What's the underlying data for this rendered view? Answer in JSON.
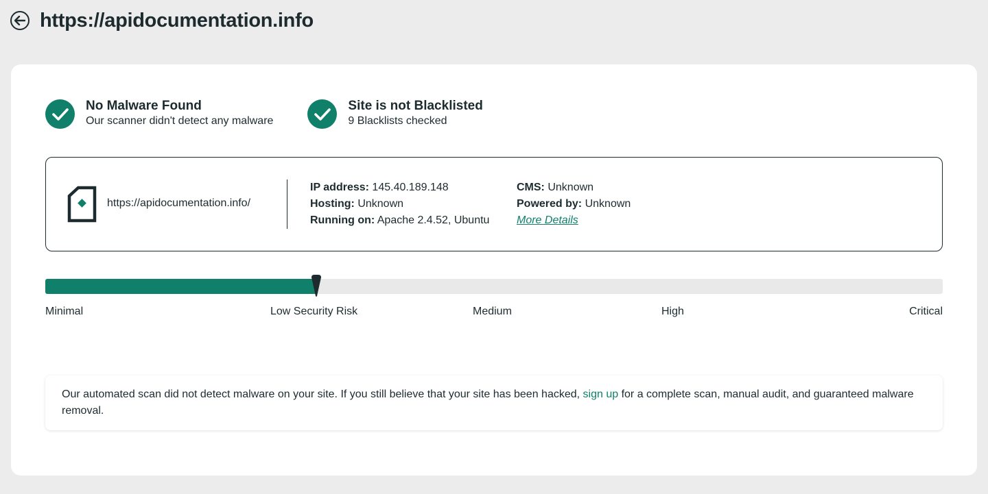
{
  "header": {
    "title": "https://apidocumentation.info",
    "back_icon": "arrow-left-circle-icon"
  },
  "status": [
    {
      "title": "No Malware Found",
      "subtitle": "Our scanner didn't detect any malware",
      "icon": "check-circle-icon"
    },
    {
      "title": "Site is not Blacklisted",
      "subtitle": "9 Blacklists checked",
      "icon": "check-circle-icon"
    }
  ],
  "site_info": {
    "url": "https://apidocumentation.info/",
    "icon": "site-page-icon",
    "ip_label": "IP address:",
    "ip_value": "145.40.189.148",
    "hosting_label": "Hosting:",
    "hosting_value": "Unknown",
    "running_label": "Running on:",
    "running_value": "Apache 2.4.52, Ubuntu",
    "cms_label": "CMS:",
    "cms_value": "Unknown",
    "powered_label": "Powered by:",
    "powered_value": "Unknown",
    "more_details": "More Details"
  },
  "risk": {
    "level_fraction": 0.302,
    "labels": [
      "Minimal",
      "Low Security Risk",
      "Medium",
      "High",
      "Critical"
    ],
    "current": "Low Security Risk"
  },
  "notice": {
    "text_before": "Our automated scan did not detect malware on your site. If you still believe that your site has been hacked, ",
    "link": "sign up",
    "text_after": " for a complete scan, manual audit, and guaranteed malware removal."
  },
  "colors": {
    "accent": "#10806a",
    "text": "#1d2b2f",
    "background": "#ececec"
  }
}
